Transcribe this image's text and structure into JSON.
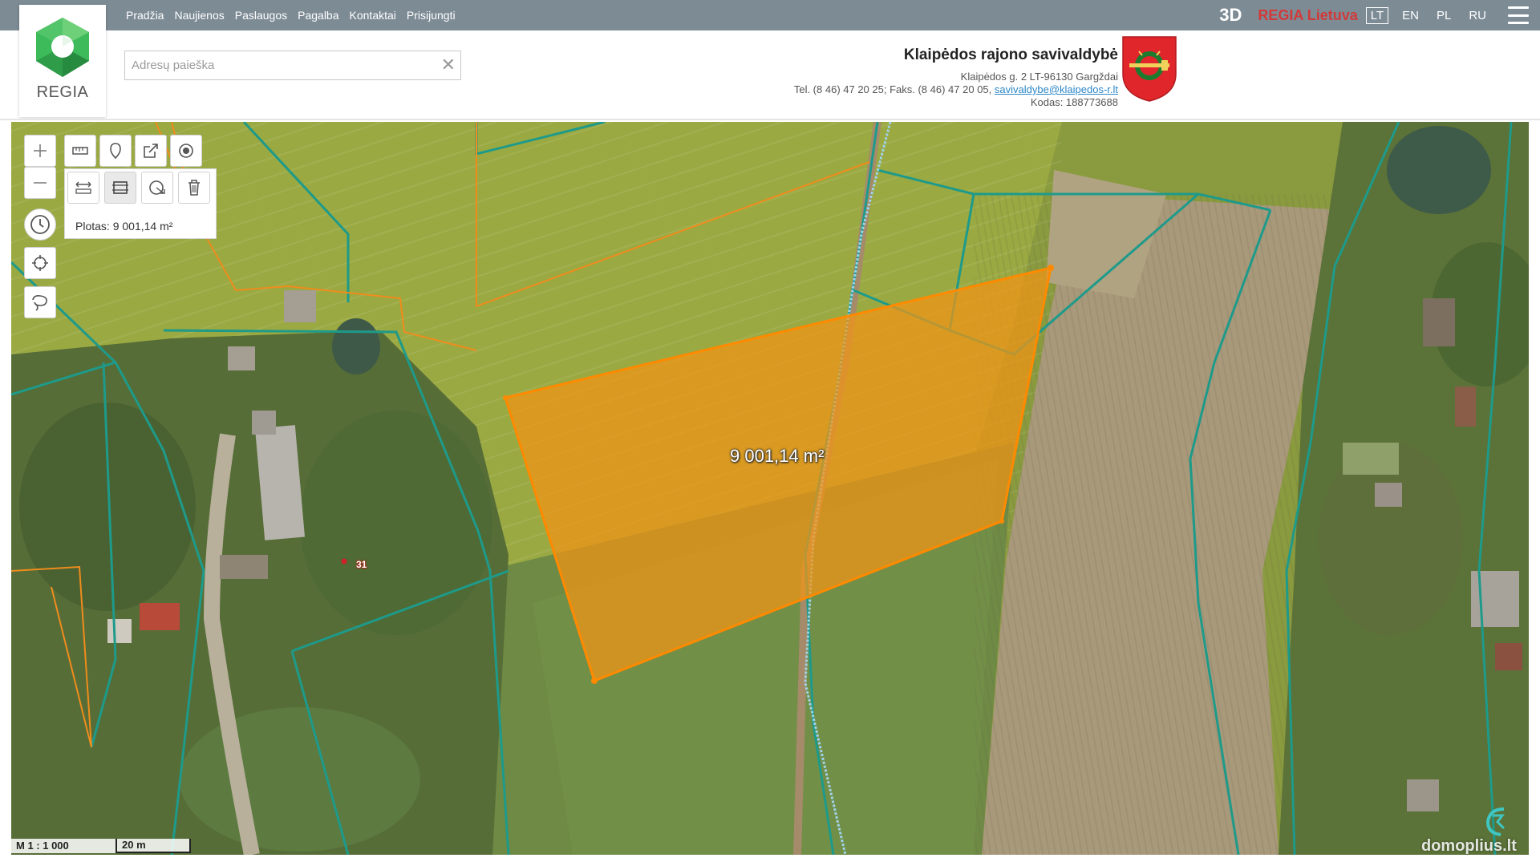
{
  "nav": {
    "items": [
      "Pradžia",
      "Naujienos",
      "Paslaugos",
      "Pagalba",
      "Kontaktai",
      "Prisijungti"
    ],
    "btn_3d": "3D",
    "regia_lietuva": "REGIA Lietuva",
    "languages": [
      "LT",
      "EN",
      "PL",
      "RU"
    ],
    "active_language": "LT"
  },
  "logo": {
    "text": "REGIA"
  },
  "search": {
    "placeholder": "Adresų paieška",
    "value": "",
    "clear_icon": "close-icon"
  },
  "municipality": {
    "name": "Klaipėdos rajono savivaldybė",
    "address": "Klaipėdos g. 2 LT-96130 Gargždai",
    "contact_prefix": "Tel. (8 46) 47 20 25; Faks. (8 46) 47 20 05, ",
    "email": "savivaldybe@klaipedos-r.lt",
    "code": "Kodas: 188773688"
  },
  "map": {
    "measurement": "Plotas: 9 001,14 m²",
    "polygon_label": "9 001,14 m²",
    "parcel_number": "31",
    "scale_ratio": "M 1 : 1 000",
    "scale_bar": "20 m",
    "watermark": "domoplius.lt"
  },
  "toolbar": {
    "icons": [
      "zoom-in-icon",
      "zoom-out-icon",
      "history-icon",
      "locate-icon",
      "lasso-icon",
      "measure-length-icon",
      "marker-icon",
      "export-icon",
      "point-icon",
      "measure-distance-icon",
      "measure-area-icon",
      "measure-radius-icon",
      "delete-icon"
    ]
  },
  "colors": {
    "topbar": "#7d8b95",
    "accent_red": "#d23a3a",
    "parcel_teal": "#1e9a8a",
    "boundary_orange": "#f08c1c",
    "polygon_fill": "#f39415"
  }
}
